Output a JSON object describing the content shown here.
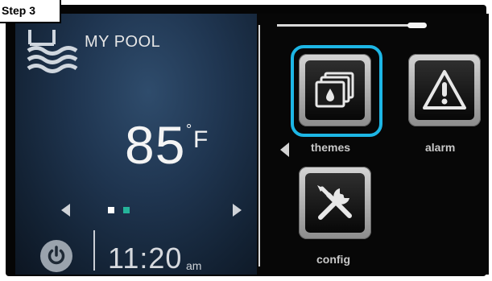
{
  "step_label": "Step 3",
  "status": {
    "title": "MY POOL",
    "temperature": "85",
    "temperature_unit": "F",
    "degree_symbol": "°"
  },
  "clock": {
    "time": "11:20",
    "ampm": "am"
  },
  "menu": {
    "themes_label": "themes",
    "alarm_label": "alarm",
    "config_label": "config"
  },
  "icons": [
    "pool-waves-icon",
    "power-icon",
    "themes-stack-icon",
    "alarm-warning-icon",
    "config-tools-icon",
    "arrow-left-icon",
    "arrow-right-icon"
  ],
  "colors": {
    "highlight": "#1db6e5",
    "active_dot": "#25b49a"
  },
  "pager": {
    "pages": 2,
    "active_page": 1
  }
}
